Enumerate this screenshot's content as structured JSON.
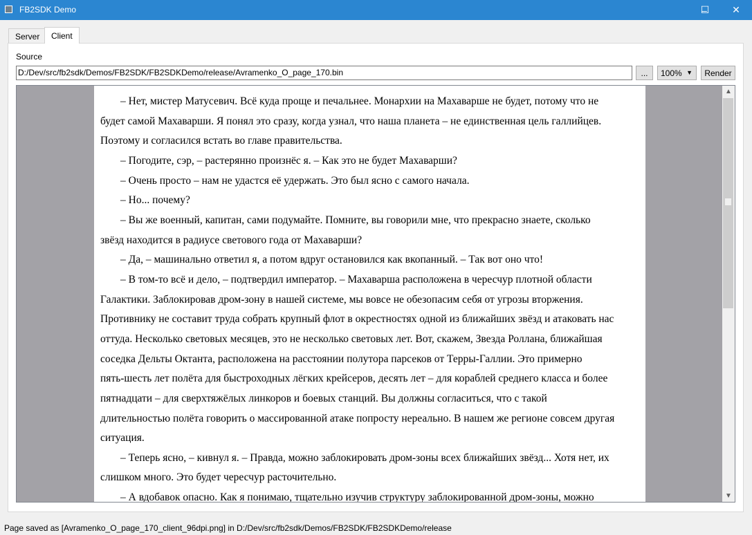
{
  "window": {
    "title": "FB2SDK Demo",
    "minimize": "–",
    "maximize": "☐",
    "close": "✕"
  },
  "tabs": [
    {
      "label": "Server",
      "active": false
    },
    {
      "label": "Client",
      "active": true
    }
  ],
  "source": {
    "label": "Source",
    "value": "D:/Dev/src/fb2sdk/Demos/FB2SDK/FB2SDKDemo/release/Avramenko_O_page_170.bin",
    "browse_label": "...",
    "zoom_value": "100%",
    "render_label": "Render"
  },
  "page_lines": [
    {
      "text": "– Нет, мистер Матусевич. Всё куда проще и печальнее. Монархии на Махаварше не будет, потому что не",
      "indent": true
    },
    {
      "text": "будет самой Махаварши. Я понял это сразу, когда узнал, что наша планета – не единственная цель галлийцев.",
      "indent": false
    },
    {
      "text": "Поэтому и согласился встать во главе правительства.",
      "indent": false
    },
    {
      "text": "– Погодите, сэр, – растерянно произнёс я. – Как это не будет Махаварши?",
      "indent": true
    },
    {
      "text": "– Очень просто – нам не удастся её удержать. Это был ясно с самого начала.",
      "indent": true
    },
    {
      "text": "– Но... почему?",
      "indent": true
    },
    {
      "text": "– Вы же военный, капитан, сами подумайте. Помните, вы говорили мне, что прекрасно знаете, сколько",
      "indent": true
    },
    {
      "text": "звёзд находится в радиусе светового года от Махаварши?",
      "indent": false
    },
    {
      "text": "– Да, – машинально ответил я, а потом вдруг остановился как вкопанный. – Так вот оно что!",
      "indent": true
    },
    {
      "text": "– В том-то всё и дело, – подтвердил император. – Махаварша расположена в чересчур плотной области",
      "indent": true
    },
    {
      "text": "Галактики. Заблокировав дром-зону в нашей системе, мы вовсе не обезопасим себя от угрозы вторжения.",
      "indent": false
    },
    {
      "text": "Противнику не составит труда собрать крупный флот в окрестностях одной из ближайших звёзд и атаковать нас",
      "indent": false
    },
    {
      "text": "оттуда. Несколько световых месяцев, это не несколько световых лет. Вот, скажем, Звезда Роллана, ближайшая",
      "indent": false
    },
    {
      "text": "соседка Дельты Октанта, расположена на расстоянии полутора парсеков от Терры-Галлии. Это примерно",
      "indent": false
    },
    {
      "text": "пять-шесть лет полёта для быстроходных лёгких крейсеров, десять лет – для кораблей среднего класса и более",
      "indent": false
    },
    {
      "text": "пятнадцати – для сверхтяжёлых линкоров и боевых станций. Вы должны согласиться, что с такой",
      "indent": false
    },
    {
      "text": "длительностью полёта говорить о массированной атаке попросту нереально. В нашем же регионе совсем другая",
      "indent": false
    },
    {
      "text": "ситуация.",
      "indent": false
    },
    {
      "text": "– Теперь ясно, – кивнул я. – Правда, можно заблокировать дром-зоны всех ближайших звёзд... Хотя нет, их",
      "indent": true
    },
    {
      "text": "слишком много. Это будет чересчур расточительно.",
      "indent": false
    },
    {
      "text": "– А вдобавок опасно. Как я понимаю, тщательно изучив структуру заблокированной дром-зоны, можно",
      "indent": true
    }
  ],
  "scrollbar": {
    "position_fraction": 0.0,
    "visible_fraction": 0.5
  },
  "status": "Page saved as [Avramenko_O_page_170_client_96dpi.png] in D:/Dev/src/fb2sdk/Demos/FB2SDK/FB2SDKDemo/release",
  "colors": {
    "titlebar": "#2b86d1",
    "viewer_bg": "#a3a2a7"
  }
}
